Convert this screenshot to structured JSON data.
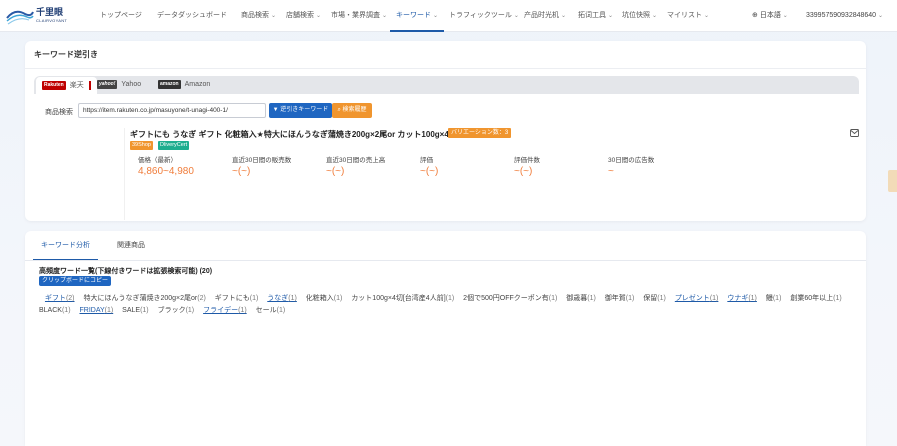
{
  "brand": {
    "name": "千里眼",
    "sub": "CLAIRVOYANT"
  },
  "nav": {
    "items": [
      {
        "label": "トップページ",
        "chevron": false,
        "active": false
      },
      {
        "label": "データダッシュボード",
        "chevron": false,
        "active": false
      },
      {
        "label": "商品検索",
        "chevron": true,
        "active": false
      },
      {
        "label": "店舗検索",
        "chevron": true,
        "active": false
      },
      {
        "label": "市場・業界調査",
        "chevron": true,
        "active": false
      },
      {
        "label": "キーワード",
        "chevron": true,
        "active": true
      },
      {
        "label": "トラフィックツール",
        "chevron": true,
        "active": false
      },
      {
        "label": "产品时光机",
        "chevron": true,
        "active": false
      },
      {
        "label": "拓词工具",
        "chevron": true,
        "active": false
      },
      {
        "label": "坑位快照",
        "chevron": true,
        "active": false
      },
      {
        "label": "マイリスト",
        "chevron": true,
        "active": false
      }
    ],
    "language": "日本語",
    "user": "33995759093284864​0"
  },
  "page": {
    "title": "キーワード逆引き"
  },
  "marketplaces": [
    {
      "logo": "Rakuten",
      "label": "楽天",
      "active": true
    },
    {
      "logo": "yahoo!",
      "label": "Yahoo",
      "active": false
    },
    {
      "logo": "amazon",
      "label": "Amazon",
      "active": false
    }
  ],
  "search": {
    "label": "商品検索",
    "value": "https://item.rakuten.co.jp/masuyone/t-unagi-400-1/",
    "reverse_button": "逆引きキーワード",
    "history_button": "検索履歴"
  },
  "product": {
    "title": "ギフトにも うなぎ ギフト 化粧箱入★特大にほんうなぎ蒲焼き200g×2尾or カット100g×4...",
    "variation_badge": "バリエーション数：3",
    "tags": [
      "39Shop",
      "DliveryCert"
    ],
    "stats": [
      {
        "label": "価格（最新）",
        "value": "4,860~4,980"
      },
      {
        "label": "直近30日間の販売数",
        "value": "~(~)"
      },
      {
        "label": "直近30日間の売上高",
        "value": "~(~)"
      },
      {
        "label": "評価",
        "value": "~(~)"
      },
      {
        "label": "評価件数",
        "value": "~(~)"
      },
      {
        "label": "30日間の広告数",
        "value": "~"
      }
    ]
  },
  "subtabs": [
    {
      "label": "キーワード分析",
      "active": true
    },
    {
      "label": "関連商品",
      "active": false
    }
  ],
  "keywords": {
    "header": "高頻度ワード一覧(下線付きワードは拡張検索可能) (20)",
    "copy_button": "クリップボードにコピー",
    "items": [
      {
        "word": "ギフト",
        "count": "(2)",
        "link": true
      },
      {
        "word": "特大にほんうなぎ蒲焼き200g×2尾or",
        "count": "(2)",
        "link": false
      },
      {
        "word": "ギフトにも",
        "count": "(1)",
        "link": false
      },
      {
        "word": "うなぎ",
        "count": "(1)",
        "link": true
      },
      {
        "word": "化粧箱入",
        "count": "(1)",
        "link": false
      },
      {
        "word": "カット100g×4切[台湾産4人前]",
        "count": "(1)",
        "link": false
      },
      {
        "word": "2個で500円OFFクーポン有",
        "count": "(1)",
        "link": false
      },
      {
        "word": "御歳暮",
        "count": "(1)",
        "link": false
      },
      {
        "word": "御年賀",
        "count": "(1)",
        "link": false
      },
      {
        "word": "保留",
        "count": "(1)",
        "link": false
      },
      {
        "word": "プレゼント",
        "count": "(1)",
        "link": true
      },
      {
        "word": "ウナギ",
        "count": "(1)",
        "link": true
      },
      {
        "word": "鰻",
        "count": "(1)",
        "link": false
      },
      {
        "word": "創業60年以上",
        "count": "(1)",
        "link": false
      },
      {
        "word": "BLACK",
        "count": "(1)",
        "link": false
      },
      {
        "word": "FRIDAY",
        "count": "(1)",
        "link": true
      },
      {
        "word": "SALE",
        "count": "(1)",
        "link": false
      },
      {
        "word": "ブラック",
        "count": "(1)",
        "link": false
      },
      {
        "word": "フライデー",
        "count": "(1)",
        "link": true
      },
      {
        "word": "セール",
        "count": "(1)",
        "link": false
      }
    ]
  },
  "colors": {
    "primary": "#1f66c1",
    "accent_orange": "#f0952e",
    "value_orange": "#f07c3a",
    "tag_green": "#1fae8f",
    "rakuten_red": "#bf0000"
  }
}
